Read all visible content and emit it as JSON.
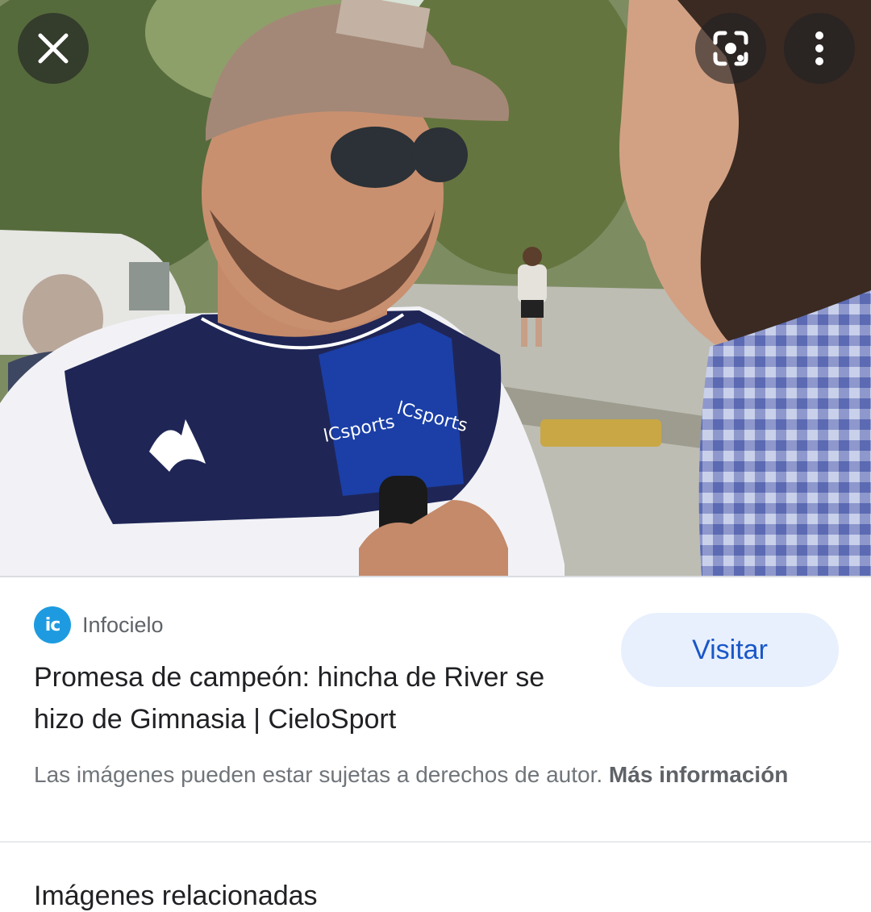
{
  "viewer": {
    "image_alt": "Hincha con camiseta de Gimnasia siendo entrevistado",
    "close_icon": "close-icon",
    "lens_icon": "lens-icon",
    "more_icon": "more-vert-icon",
    "mic_text_1": "lCsports",
    "mic_text_2": "lCsports"
  },
  "result": {
    "source_logo_text": "ic",
    "source_name": "Infocielo",
    "visit_label": "Visitar",
    "title": "Promesa de campeón: hincha de River se hizo de Gimnasia | CieloSport",
    "copyright_text": "Las imágenes pueden estar sujetas a derechos de autor.",
    "more_info_label": "Más información"
  },
  "related": {
    "heading": "Imágenes relacionadas"
  },
  "colors": {
    "accent": "#1a57c7",
    "visit_bg": "#e8f0fe",
    "logo": "#1e9be0"
  }
}
